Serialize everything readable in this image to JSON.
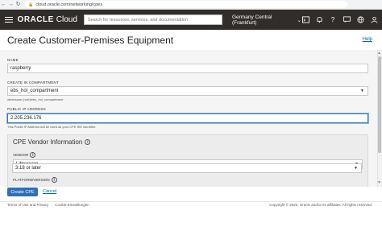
{
  "browser": {
    "url": "cloud.oracle.com/networking/cpes"
  },
  "header": {
    "logo_primary": "ORACLE",
    "logo_secondary": "Cloud",
    "search_placeholder": "Search for resources, services, and documentation",
    "region": "Germany Central (Frankfurt)"
  },
  "page": {
    "title": "Create Customer-Premises Equipment",
    "help": "Help"
  },
  "form": {
    "name_label": "NAME",
    "name_value": "raspberry",
    "compartment_label": "CREATE IN COMPARTMENT",
    "compartment_value": "ebs_hol_compartment",
    "compartment_path": "oliversaas (root)/ebs_hol_compartment",
    "ip_label": "PUBLIC IP ADDRESS",
    "ip_value": "2.205.236.176",
    "ip_helper": "This Public IP Address will be used as your CPE IKE identifier."
  },
  "vendor_section": {
    "title": "CPE Vendor Information",
    "vendor_label": "VENDOR",
    "vendor_value": "Libreswan",
    "platform_label": "PLATFORM/VERSION",
    "platform_value": "3.18 or later"
  },
  "actions": {
    "create": "Create CPE",
    "cancel": "Cancel"
  },
  "footer": {
    "terms": "Terms of Use and Privacy",
    "cookies": "Cookie-Einstellungen",
    "copyright": "Copyright © 2020, Oracle and/or its affiliates. All rights reserved."
  }
}
